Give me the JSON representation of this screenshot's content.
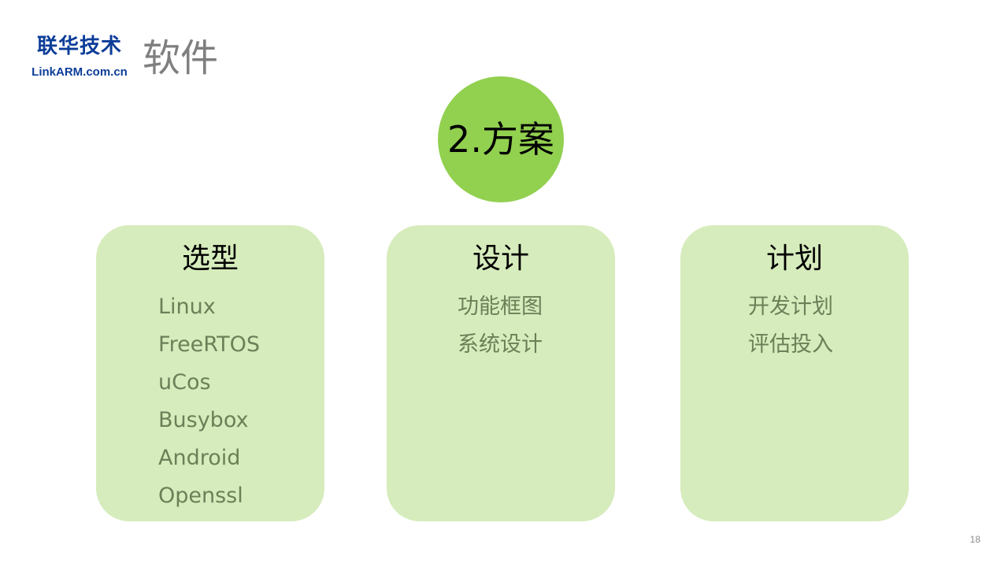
{
  "logo": {
    "name_cn": "联华技术",
    "site": "LinkARM.com.cn"
  },
  "title": "软件",
  "center": {
    "label": "2.方案"
  },
  "cards": [
    {
      "title": "选型",
      "items": [
        "Linux",
        "FreeRTOS",
        "uCos",
        "Busybox",
        "Android",
        "Openssl"
      ]
    },
    {
      "title": "设计",
      "items": [
        "功能框图",
        "系统设计"
      ]
    },
    {
      "title": "计划",
      "items": [
        "开发计划",
        "评估投入"
      ]
    }
  ],
  "page_number": "18",
  "colors": {
    "logo": "#0c3d98",
    "title": "#7f7f7f",
    "circle": "#92d050",
    "card_background": "#d6ecbc",
    "card_item_text": "#6b8058"
  }
}
